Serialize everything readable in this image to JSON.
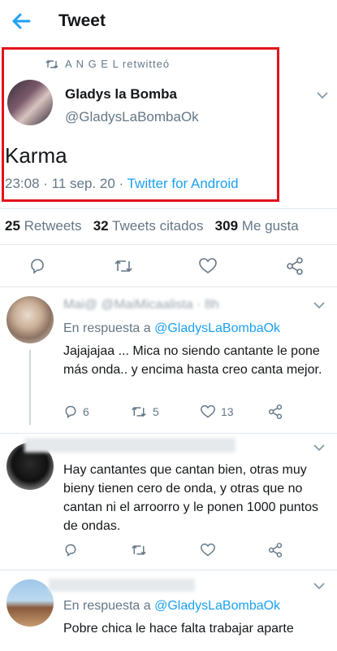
{
  "header": {
    "title": "Tweet"
  },
  "retweet_label": "A N G E L retwitteó",
  "tweet": {
    "display_name": "Gladys la Bomba",
    "handle": "@GladysLaBombaOk",
    "text": "Karma",
    "timestamp": "23:08 · 11 sep. 20 · ",
    "source": "Twitter for Android"
  },
  "stats": {
    "retweets_count": "25",
    "retweets_label": "Retweets",
    "quotes_count": "32",
    "quotes_label": "Tweets citados",
    "likes_count": "309",
    "likes_label": "Me gusta"
  },
  "replies": [
    {
      "name": "Mai@ @MaiMicaalista · 8h",
      "replying_prefix": "En respuesta a ",
      "replying_to": "@GladysLaBombaOk",
      "text": "Jajajajaa ... Mica no siendo cantante le pone más onda.. y encima hasta creo canta mejor.",
      "reply_count": "6",
      "retweet_count": "5",
      "like_count": "13"
    },
    {
      "name": "",
      "text": "Hay cantantes que cantan bien, otras muy bieny tienen cero de onda, y otras que no cantan ni el arroorro y le ponen 1000 puntos de ondas."
    },
    {
      "name": "",
      "replying_prefix": "En respuesta a ",
      "replying_to": "@GladysLaBombaOk",
      "text": "Pobre chica le hace falta trabajar aparte"
    }
  ],
  "colors": {
    "accent": "#1da1f2",
    "muted": "#657786",
    "highlight_border": "#e3121c"
  }
}
